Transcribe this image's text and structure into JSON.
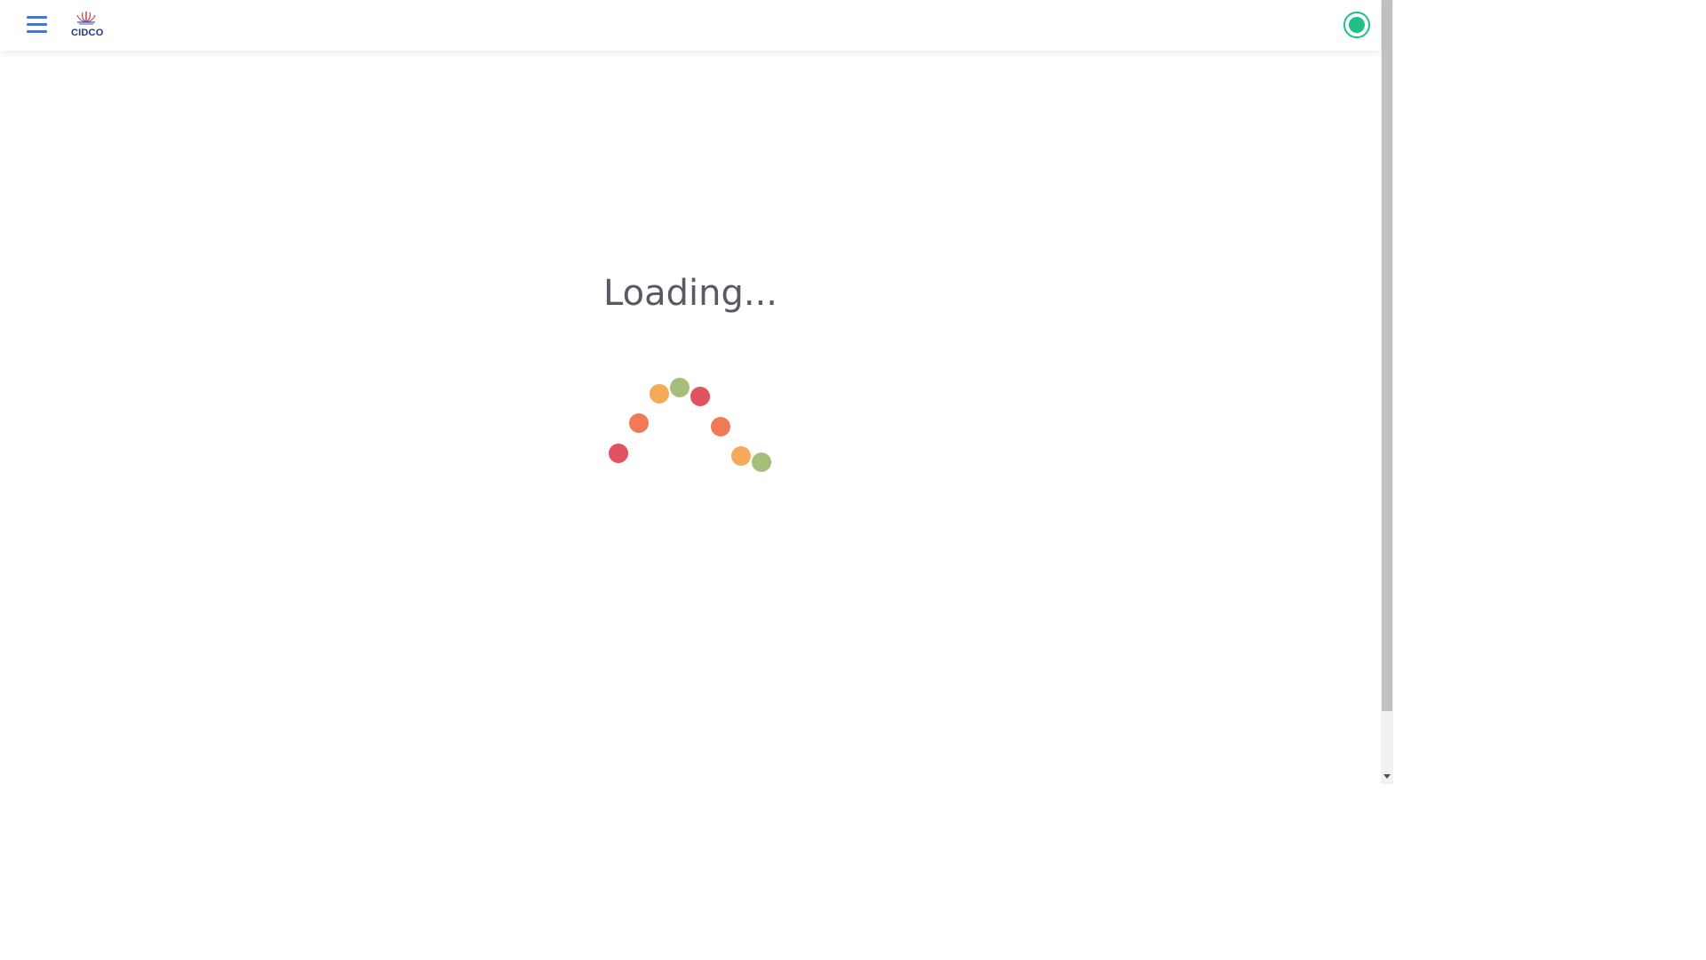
{
  "header": {
    "logo_text": "CIDCO",
    "status_color": "#1fbf85",
    "accent_color": "#4a74d6"
  },
  "loading": {
    "text": "Loading...",
    "dot_colors": [
      "#e05260",
      "#f07a55",
      "#f5aa5a",
      "#a7be7b",
      "#e05260",
      "#f07a55",
      "#f5aa5a",
      "#a7be7b"
    ]
  }
}
